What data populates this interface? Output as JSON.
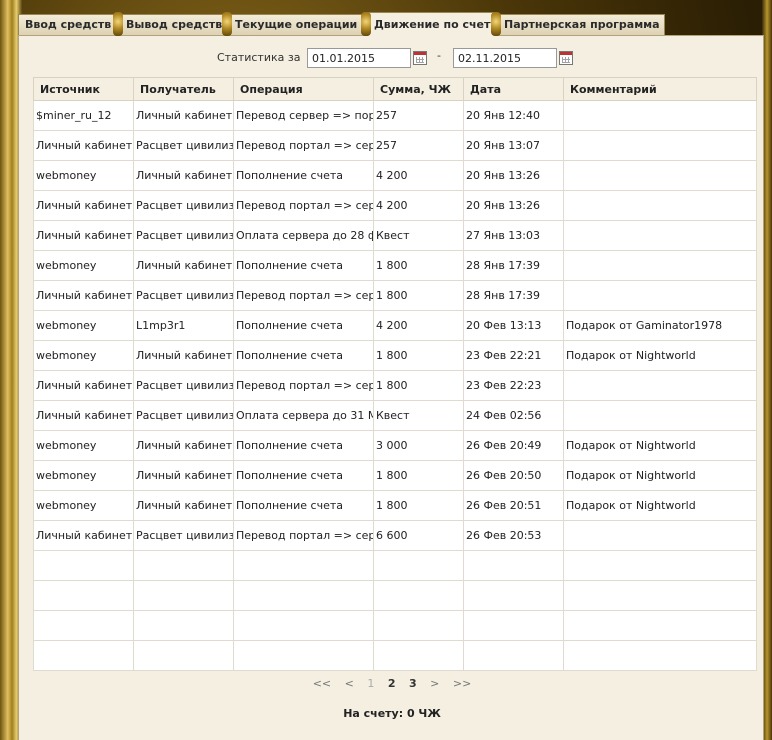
{
  "tabs": [
    {
      "label": "Ввод средств",
      "active": false
    },
    {
      "label": "Вывод средств",
      "active": false
    },
    {
      "label": "Текущие операции",
      "active": false
    },
    {
      "label": "Движение по счету",
      "active": true
    },
    {
      "label": "Партнерская программа",
      "active": false
    }
  ],
  "filter": {
    "label": "Статистика за",
    "date_from": "01.01.2015",
    "separator": "-",
    "date_to": "02.11.2015",
    "calendar_icon": "calendar-icon"
  },
  "table": {
    "columns": [
      "Источник",
      "Получатель",
      "Операция",
      "Сумма, ЧЖ",
      "Дата",
      "Комментарий"
    ],
    "rows": [
      [
        "$miner_ru_12",
        "Личный кабинет",
        "Перевод сервер => пор",
        "257",
        "20 Янв 12:40",
        ""
      ],
      [
        "Личный кабинет",
        "Расцвет цивилиз",
        "Перевод портал => сер",
        "257",
        "20 Янв 13:07",
        ""
      ],
      [
        "webmoney",
        "Личный кабинет",
        "Пополнение счета",
        "4 200",
        "20 Янв 13:26",
        ""
      ],
      [
        "Личный кабинет",
        "Расцвет цивилиз",
        "Перевод портал => сер",
        "4 200",
        "20 Янв 13:26",
        ""
      ],
      [
        "Личный кабинет",
        "Расцвет цивилиз",
        "Оплата сервера до 28 ф",
        "Квест",
        "27 Янв 13:03",
        ""
      ],
      [
        "webmoney",
        "Личный кабинет",
        "Пополнение счета",
        "1 800",
        "28 Янв 17:39",
        ""
      ],
      [
        "Личный кабинет",
        "Расцвет цивилиз",
        "Перевод портал => сер",
        "1 800",
        "28 Янв 17:39",
        ""
      ],
      [
        "webmoney",
        "L1mp3r1",
        "Пополнение счета",
        "4 200",
        "20 Фев 13:13",
        "Подарок от Gaminator1978"
      ],
      [
        "webmoney",
        "Личный кабинет",
        "Пополнение счета",
        "1 800",
        "23 Фев 22:21",
        "Подарок от Nightworld"
      ],
      [
        "Личный кабинет",
        "Расцвет цивилиз",
        "Перевод портал => сер",
        "1 800",
        "23 Фев 22:23",
        ""
      ],
      [
        "Личный кабинет",
        "Расцвет цивилиз",
        "Оплата сервера до 31 М",
        "Квест",
        "24 Фев 02:56",
        ""
      ],
      [
        "webmoney",
        "Личный кабинет",
        "Пополнение счета",
        "3 000",
        "26 Фев 20:49",
        "Подарок от Nightworld"
      ],
      [
        "webmoney",
        "Личный кабинет",
        "Пополнение счета",
        "1 800",
        "26 Фев 20:50",
        "Подарок от Nightworld"
      ],
      [
        "webmoney",
        "Личный кабинет",
        "Пополнение счета",
        "1 800",
        "26 Фев 20:51",
        "Подарок от Nightworld"
      ],
      [
        "Личный кабинет",
        "Расцвет цивилиз",
        "Перевод портал => сер",
        "6 600",
        "26 Фев 20:53",
        ""
      ],
      [
        "",
        "",
        "",
        "",
        "",
        ""
      ],
      [
        "",
        "",
        "",
        "",
        "",
        ""
      ],
      [
        "",
        "",
        "",
        "",
        "",
        ""
      ],
      [
        "",
        "",
        "",
        "",
        "",
        ""
      ]
    ]
  },
  "pager": {
    "first": "<<",
    "prev": "<",
    "pages": [
      "1",
      "2",
      "3"
    ],
    "current_page": "1",
    "next": ">",
    "last": ">>"
  },
  "balance": "На счету: 0 ЧЖ"
}
